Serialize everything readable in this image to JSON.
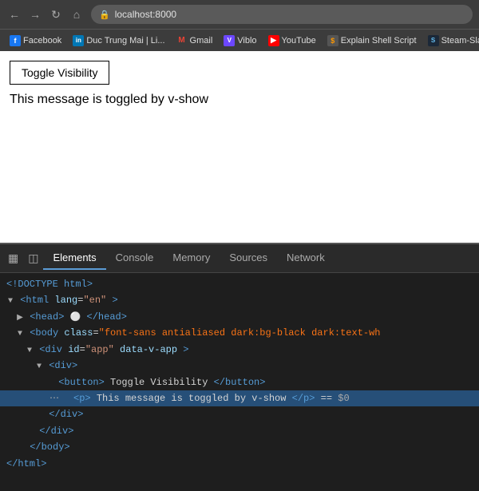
{
  "browser": {
    "url": "localhost:8000",
    "nav_back": "←",
    "nav_forward": "→",
    "nav_reload": "↻",
    "nav_home": "⌂"
  },
  "bookmarks": [
    {
      "id": "facebook",
      "label": "Facebook",
      "icon": "f",
      "icon_class": "bm-facebook"
    },
    {
      "id": "linkedin",
      "label": "Duc Trung Mai | Li...",
      "icon": "in",
      "icon_class": "bm-linkedin"
    },
    {
      "id": "gmail",
      "label": "Gmail",
      "icon": "M",
      "icon_class": "bm-gmail"
    },
    {
      "id": "viblo",
      "label": "Viblo",
      "icon": "V",
      "icon_class": "bm-viblo"
    },
    {
      "id": "youtube",
      "label": "YouTube",
      "icon": "▶",
      "icon_class": "bm-youtube"
    },
    {
      "id": "explain",
      "label": "Explain Shell Script",
      "icon": "$",
      "icon_class": "bm-explain"
    },
    {
      "id": "steam",
      "label": "Steam-Slack",
      "icon": "S",
      "icon_class": "bm-steam"
    }
  ],
  "page": {
    "button_label": "Toggle Visibility",
    "message": "This message is toggled by v-show"
  },
  "devtools": {
    "tabs": [
      {
        "id": "elements",
        "label": "Elements",
        "active": true
      },
      {
        "id": "console",
        "label": "Console",
        "active": false
      },
      {
        "id": "memory",
        "label": "Memory",
        "active": false
      },
      {
        "id": "sources",
        "label": "Sources",
        "active": false
      },
      {
        "id": "network",
        "label": "Network",
        "active": false
      }
    ],
    "html_lines": [
      {
        "indent": 0,
        "content": "<!DOCTYPE html>",
        "type": "doctype"
      },
      {
        "indent": 0,
        "content_tag": "html",
        "attr": "lang",
        "attr_val": "en",
        "closing": false
      },
      {
        "indent": 1,
        "content_tag": "head",
        "has_children": true,
        "collapsed": true
      },
      {
        "indent": 1,
        "content_tag_class": "body",
        "attr": "class",
        "attr_val_orange": true
      },
      {
        "indent": 2,
        "content": "div",
        "attr": "id",
        "attr_val": "app",
        "data_attr": "data-v-app"
      },
      {
        "indent": 3,
        "content": "div"
      },
      {
        "indent": 4,
        "content": "button_line"
      },
      {
        "indent": 4,
        "content": "p_line",
        "selected": true
      },
      {
        "indent": 3,
        "closing": "div"
      },
      {
        "indent": 2,
        "closing": "div"
      },
      {
        "indent": 1,
        "closing": "body"
      },
      {
        "indent": 0,
        "closing_tag": "html"
      }
    ]
  }
}
